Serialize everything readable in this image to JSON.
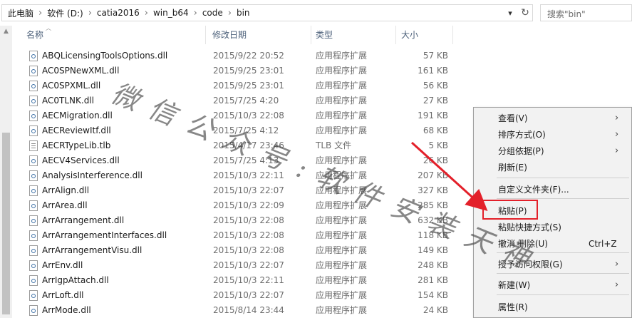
{
  "address": {
    "crumbs": [
      "此电脑",
      "软件 (D:)",
      "catia2016",
      "win_b64",
      "code",
      "bin"
    ]
  },
  "search": {
    "placeholder": "搜索\"bin\""
  },
  "columns": {
    "name": "名称",
    "date": "修改日期",
    "type": "类型",
    "size": "大小"
  },
  "files": [
    {
      "name": "ABQLicensingToolsOptions.dll",
      "date": "2015/9/22 20:52",
      "type": "应用程序扩展",
      "size": "57 KB",
      "icon": "dll-icon"
    },
    {
      "name": "AC0SPNewXML.dll",
      "date": "2015/9/25 23:01",
      "type": "应用程序扩展",
      "size": "161 KB",
      "icon": "dll-icon"
    },
    {
      "name": "AC0SPXML.dll",
      "date": "2015/9/25 23:01",
      "type": "应用程序扩展",
      "size": "56 KB",
      "icon": "dll-icon"
    },
    {
      "name": "AC0TLNK.dll",
      "date": "2015/7/25 4:20",
      "type": "应用程序扩展",
      "size": "27 KB",
      "icon": "dll-icon"
    },
    {
      "name": "AECMigration.dll",
      "date": "2015/10/3 22:08",
      "type": "应用程序扩展",
      "size": "191 KB",
      "icon": "dll-icon"
    },
    {
      "name": "AECReviewItf.dll",
      "date": "2015/7/25 4:12",
      "type": "应用程序扩展",
      "size": "68 KB",
      "icon": "dll-icon"
    },
    {
      "name": "AECRTypeLib.tlb",
      "date": "2015/4/17 23:46",
      "type": "TLB 文件",
      "size": "5 KB",
      "icon": "file-icon"
    },
    {
      "name": "AECV4Services.dll",
      "date": "2015/7/25 4:13",
      "type": "应用程序扩展",
      "size": "26 KB",
      "icon": "dll-icon"
    },
    {
      "name": "AnalysisInterference.dll",
      "date": "2015/10/3 22:11",
      "type": "应用程序扩展",
      "size": "207 KB",
      "icon": "dll-icon"
    },
    {
      "name": "ArrAlign.dll",
      "date": "2015/10/3 22:07",
      "type": "应用程序扩展",
      "size": "327 KB",
      "icon": "dll-icon"
    },
    {
      "name": "ArrArea.dll",
      "date": "2015/10/3 22:09",
      "type": "应用程序扩展",
      "size": "285 KB",
      "icon": "dll-icon"
    },
    {
      "name": "ArrArrangement.dll",
      "date": "2015/10/3 22:08",
      "type": "应用程序扩展",
      "size": "632 KB",
      "icon": "dll-icon"
    },
    {
      "name": "ArrArrangementInterfaces.dll",
      "date": "2015/10/3 22:08",
      "type": "应用程序扩展",
      "size": "118 KB",
      "icon": "dll-icon"
    },
    {
      "name": "ArrArrangementVisu.dll",
      "date": "2015/10/3 22:08",
      "type": "应用程序扩展",
      "size": "149 KB",
      "icon": "dll-icon"
    },
    {
      "name": "ArrEnv.dll",
      "date": "2015/10/3 22:07",
      "type": "应用程序扩展",
      "size": "248 KB",
      "icon": "dll-icon"
    },
    {
      "name": "ArrIgpAttach.dll",
      "date": "2015/10/3 22:11",
      "type": "应用程序扩展",
      "size": "281 KB",
      "icon": "dll-icon"
    },
    {
      "name": "ArrLoft.dll",
      "date": "2015/10/3 22:07",
      "type": "应用程序扩展",
      "size": "154 KB",
      "icon": "dll-icon"
    },
    {
      "name": "ArrMode.dll",
      "date": "2015/8/14 23:44",
      "type": "应用程序扩展",
      "size": "24 KB",
      "icon": "dll-icon"
    }
  ],
  "context_menu": {
    "items": [
      {
        "label": "查看(V)",
        "submenu": true
      },
      {
        "label": "排序方式(O)",
        "submenu": true
      },
      {
        "label": "分组依据(P)",
        "submenu": true
      },
      {
        "label": "刷新(E)",
        "submenu": false
      },
      {
        "label": "自定义文件夹(F)...",
        "submenu": false
      },
      {
        "label": "粘贴(P)",
        "submenu": false
      },
      {
        "label": "粘贴快捷方式(S)",
        "submenu": false
      },
      {
        "label": "撤消 删除(U)",
        "shortcut": "Ctrl+Z",
        "submenu": false
      },
      {
        "label": "授予访问权限(G)",
        "submenu": true
      },
      {
        "label": "新建(W)",
        "submenu": true
      },
      {
        "label": "属性(R)",
        "submenu": false
      }
    ]
  },
  "watermark": "微信公众号:软件安装天神",
  "colors": {
    "highlight_box": "#e3202a",
    "arrow": "#e3202a",
    "header_text": "#4c607a"
  }
}
